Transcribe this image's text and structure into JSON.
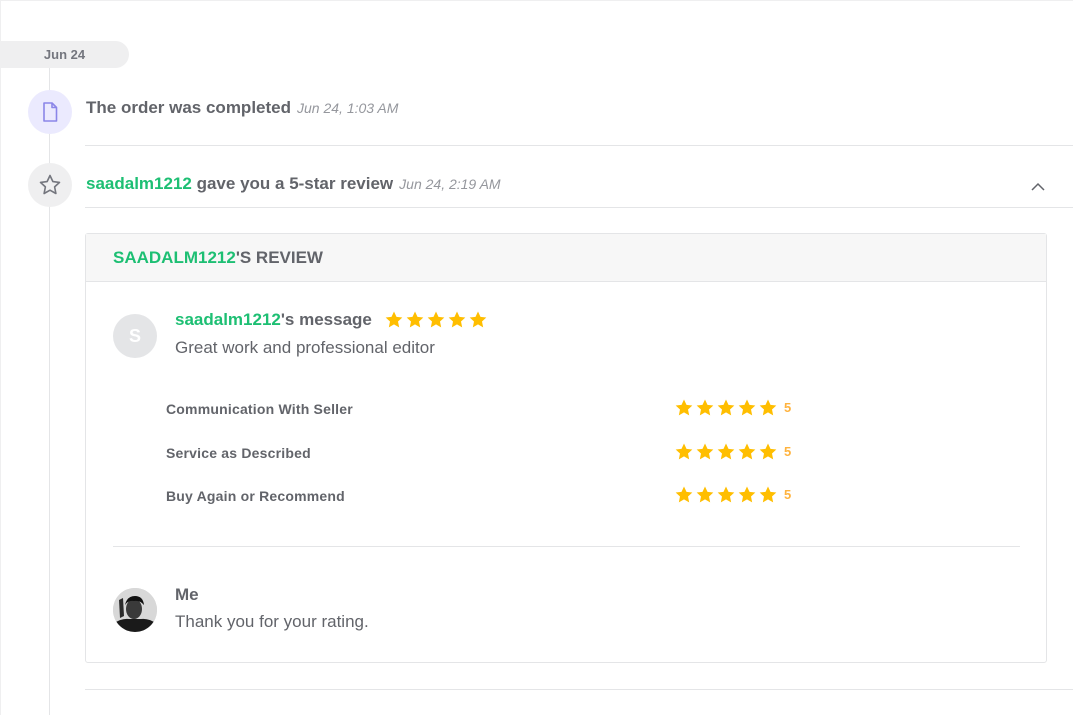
{
  "timeline": {
    "date_label": "Jun 24",
    "events": [
      {
        "text": "The order was completed",
        "time": "Jun 24, 1:03 AM",
        "icon": "document-icon"
      },
      {
        "user": "saadalm1212",
        "text": " gave you a 5-star review",
        "time": "Jun 24, 2:19 AM",
        "icon": "star-icon"
      }
    ]
  },
  "review": {
    "header_user": "SAADALM1212",
    "header_suffix": "'S REVIEW",
    "buyer": {
      "avatar_initial": "S",
      "name": "saadalm1212",
      "name_suffix": "'s message",
      "stars": 5,
      "message": "Great work and professional editor"
    },
    "ratings": [
      {
        "label": "Communication With Seller",
        "value": "5",
        "stars": 5
      },
      {
        "label": "Service as Described",
        "value": "5",
        "stars": 5
      },
      {
        "label": "Buy Again or Recommend",
        "value": "5",
        "stars": 5
      }
    ],
    "reply": {
      "name": "Me",
      "message": "Thank you for your rating."
    }
  },
  "colors": {
    "accent_green": "#1dbf73",
    "star_yellow": "#ffbe00",
    "rating_value": "#ffb33e",
    "doc_icon_bg": "#ebeafe",
    "doc_icon": "#8b86e8"
  }
}
